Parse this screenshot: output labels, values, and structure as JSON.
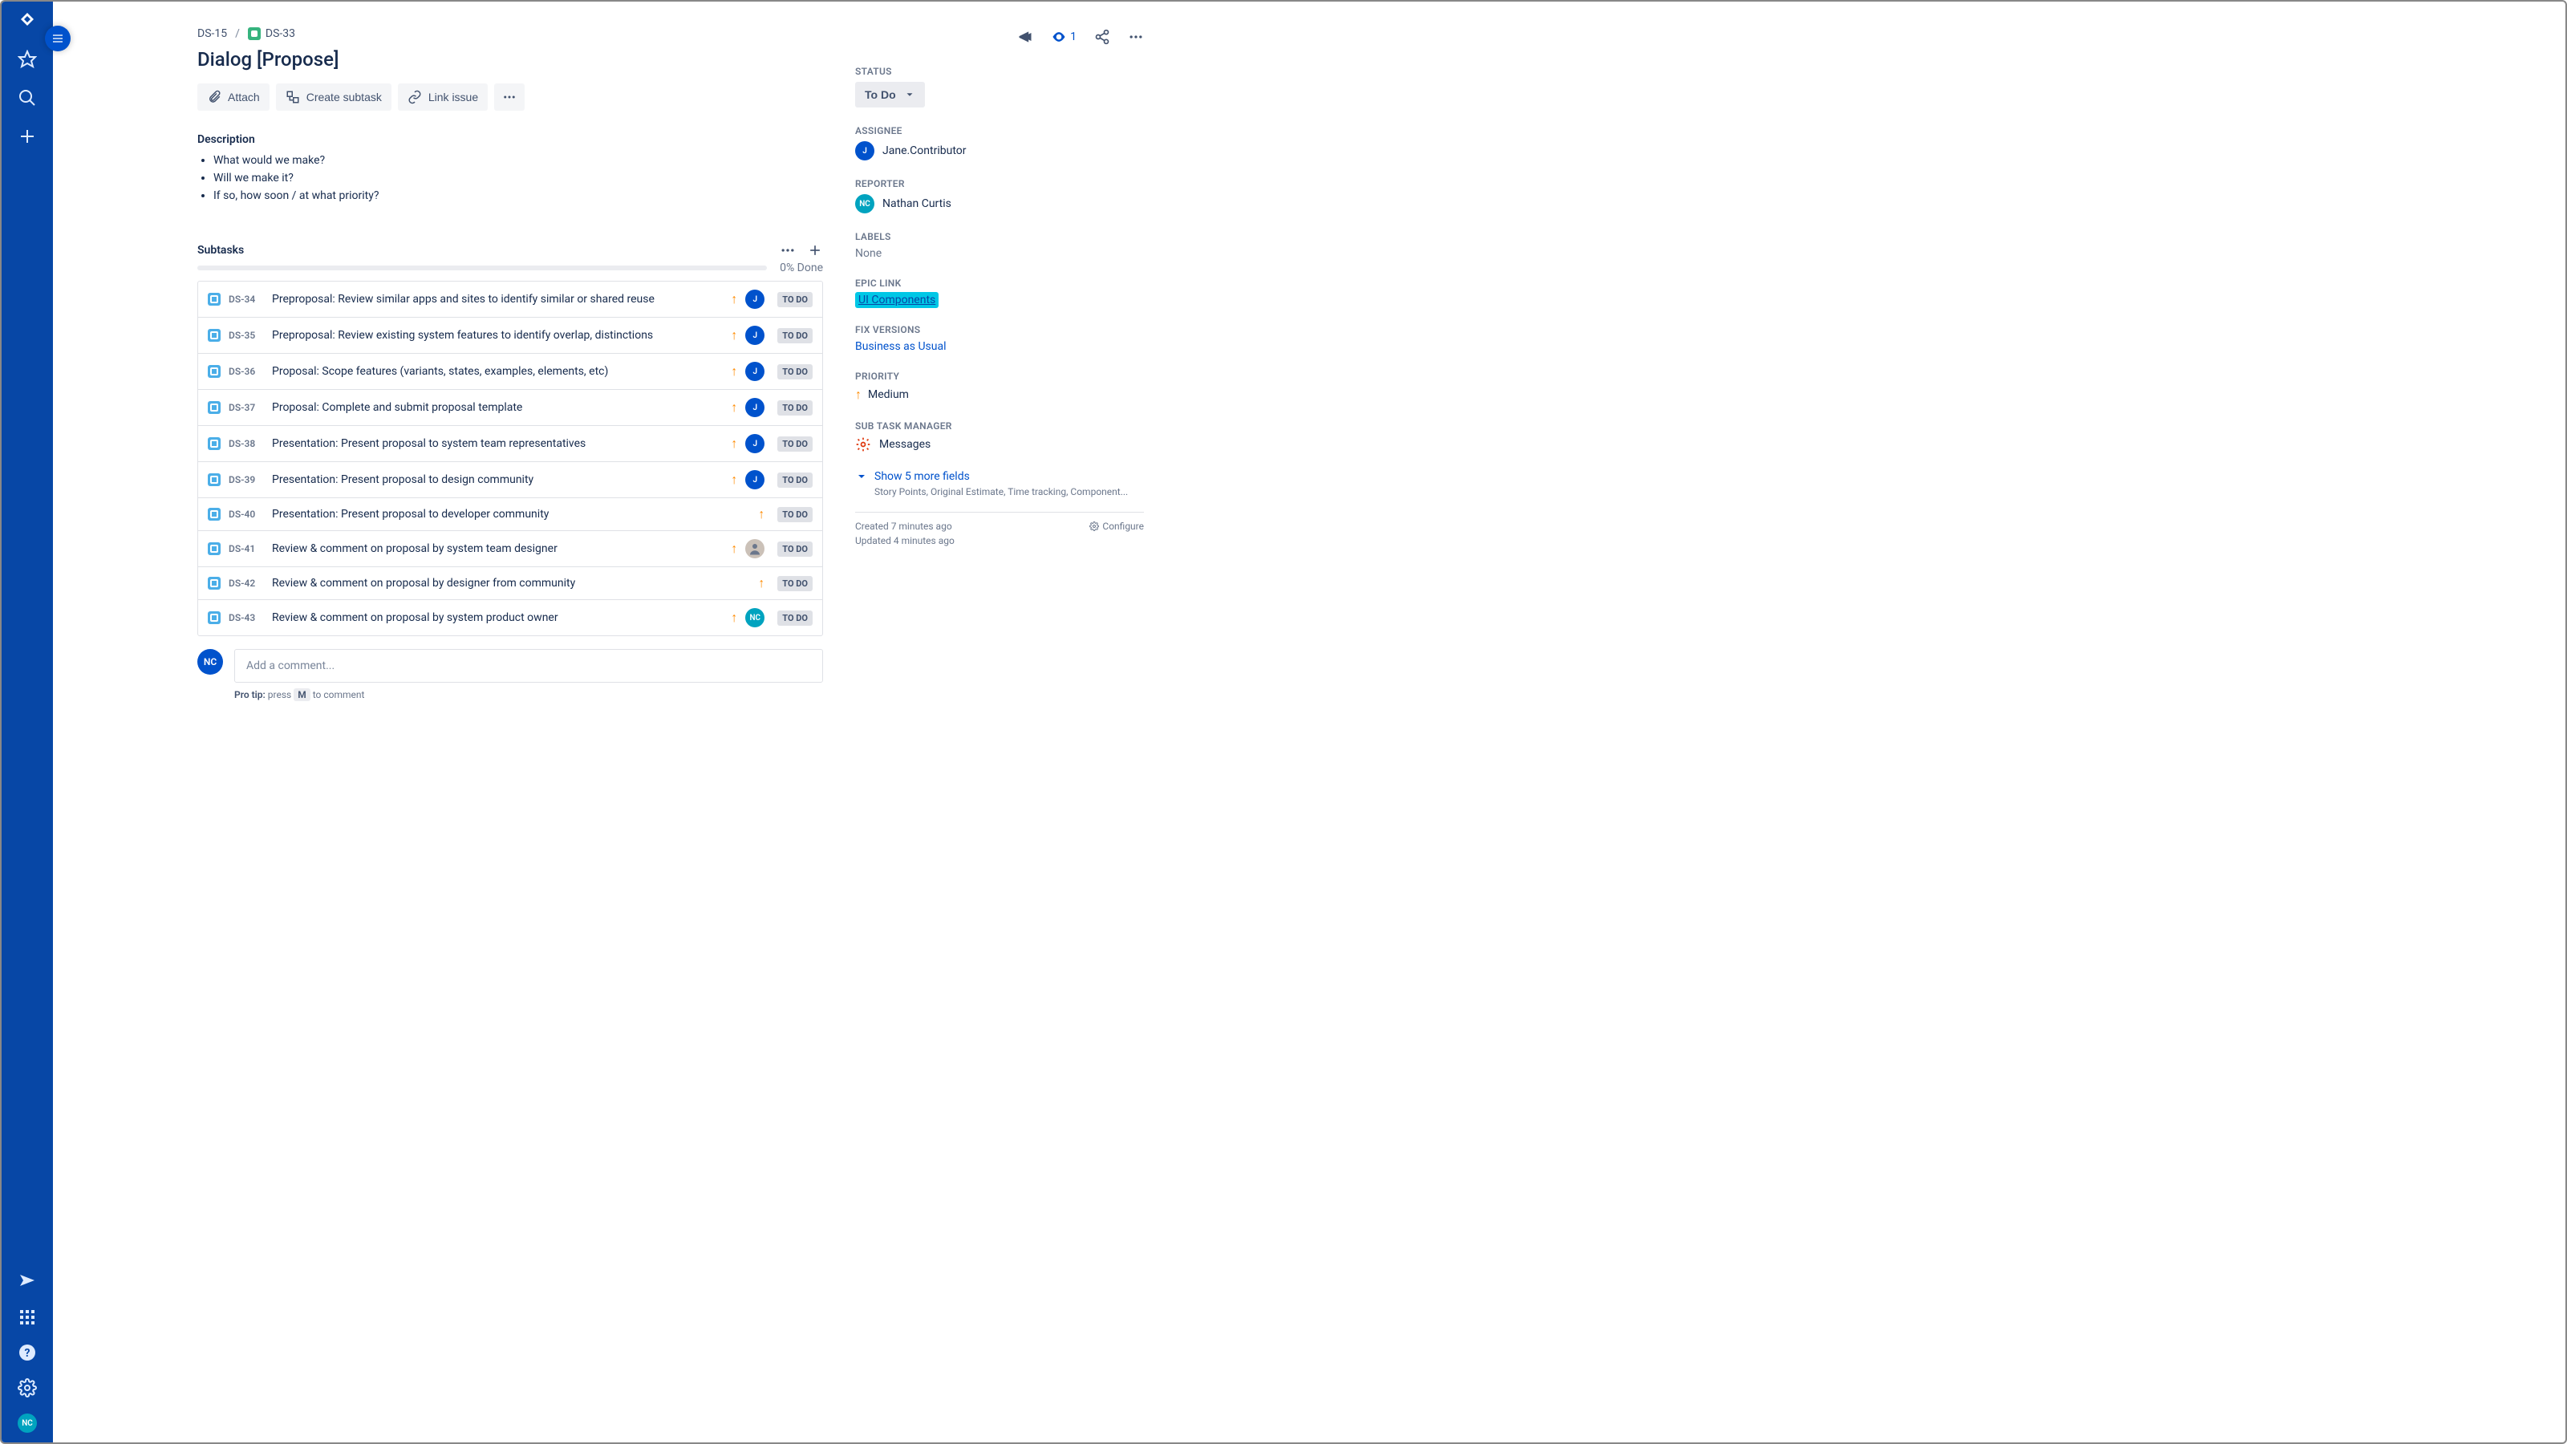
{
  "breadcrumb": {
    "parent": "DS-15",
    "current": "DS-33"
  },
  "title": "Dialog [Propose]",
  "toolbar": {
    "attach": "Attach",
    "create_subtask": "Create subtask",
    "link_issue": "Link issue"
  },
  "description": {
    "label": "Description",
    "items": [
      "What would we make?",
      "Will we make it?",
      "If so, how soon / at what priority?"
    ]
  },
  "subtasks": {
    "label": "Subtasks",
    "progress_text": "0% Done",
    "rows": [
      {
        "key": "DS-34",
        "title": "Preproposal: Review similar apps and sites to identify similar or shared reuse",
        "assignee": "J",
        "status": "TO DO"
      },
      {
        "key": "DS-35",
        "title": "Preproposal: Review existing system features to identify overlap, distinctions",
        "assignee": "J",
        "status": "TO DO"
      },
      {
        "key": "DS-36",
        "title": "Proposal: Scope features (variants, states, examples, elements, etc)",
        "assignee": "J",
        "status": "TO DO"
      },
      {
        "key": "DS-37",
        "title": "Proposal: Complete and submit proposal template",
        "assignee": "J",
        "status": "TO DO"
      },
      {
        "key": "DS-38",
        "title": "Presentation: Present proposal to system team representatives",
        "assignee": "J",
        "status": "TO DO"
      },
      {
        "key": "DS-39",
        "title": "Presentation: Present proposal to design community",
        "assignee": "J",
        "status": "TO DO"
      },
      {
        "key": "DS-40",
        "title": "Presentation: Present proposal to developer community",
        "assignee": "",
        "status": "TO DO"
      },
      {
        "key": "DS-41",
        "title": "Review & comment on proposal by system team designer",
        "assignee": "IMG",
        "status": "TO DO"
      },
      {
        "key": "DS-42",
        "title": "Review & comment on proposal by designer from community",
        "assignee": "",
        "status": "TO DO"
      },
      {
        "key": "DS-43",
        "title": "Review & comment on proposal by system product owner",
        "assignee": "NC",
        "status": "TO DO"
      }
    ]
  },
  "comment": {
    "placeholder": "Add a comment...",
    "protip_prefix": "Pro tip:",
    "protip_press": "press",
    "protip_key": "M",
    "protip_suffix": "to comment"
  },
  "header": {
    "watchers": "1"
  },
  "sidebar": {
    "status": {
      "label": "STATUS",
      "value": "To Do"
    },
    "assignee": {
      "label": "ASSIGNEE",
      "name": "Jane.Contributor",
      "initials": "J"
    },
    "reporter": {
      "label": "REPORTER",
      "name": "Nathan Curtis",
      "initials": "NC"
    },
    "labels": {
      "label": "LABELS",
      "value": "None"
    },
    "epic": {
      "label": "EPIC LINK",
      "value": "UI Components"
    },
    "fix": {
      "label": "FIX VERSIONS",
      "value": "Business as Usual"
    },
    "priority": {
      "label": "PRIORITY",
      "value": "Medium"
    },
    "stm": {
      "label": "SUB TASK MANAGER",
      "value": "Messages"
    },
    "show_more": "Show 5 more fields",
    "show_more_sub": "Story Points, Original Estimate, Time tracking, Component...",
    "created": "Created 7 minutes ago",
    "updated": "Updated 4 minutes ago",
    "configure": "Configure"
  }
}
